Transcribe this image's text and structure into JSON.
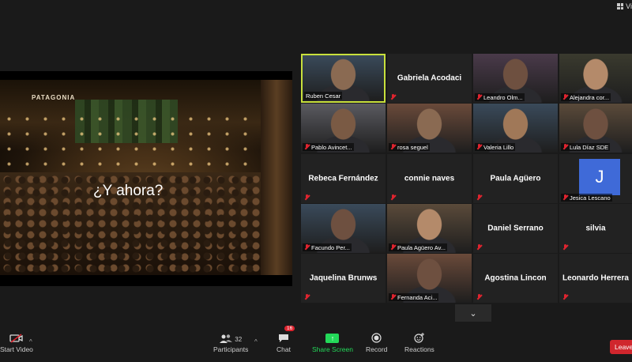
{
  "topbar": {
    "view_label": "Vi"
  },
  "shared_screen": {
    "overlay_text": "¿Y ahora?",
    "sign_text": "PATAGONIA"
  },
  "participants": [
    {
      "name": "Ruben Cesar",
      "video": true
    },
    {
      "name": "Gabriela Acodaci",
      "video": false
    },
    {
      "name": "Leandro Olm...",
      "video": true
    },
    {
      "name": "Alejandra cor...",
      "video": true
    },
    {
      "name": "Pablo Avincet...",
      "video": true
    },
    {
      "name": "rosa seguel",
      "video": true
    },
    {
      "name": "Valeria Lillo",
      "video": true
    },
    {
      "name": "Lula Díaz SDE",
      "video": true
    },
    {
      "name": "Rebeca Fernández",
      "video": false
    },
    {
      "name": "connie naves",
      "video": false
    },
    {
      "name": "Paula Agüero",
      "video": false
    },
    {
      "name": "Jesica Lescano",
      "avatar_letter": "J"
    },
    {
      "name": "Facundo Per...",
      "video": true
    },
    {
      "name": "Paula Agüero Av...",
      "video": true
    },
    {
      "name": "Daniel Serrano",
      "video": false
    },
    {
      "name": "silvia",
      "video": false
    },
    {
      "name": "Jaquelina Brunws",
      "video": false
    },
    {
      "name": "Fernanda Aci...",
      "video": true
    },
    {
      "name": "Agostina Lincon",
      "video": false
    },
    {
      "name": "Leonardo Herrera",
      "video": false
    }
  ],
  "more_button": {
    "icon": "chevron-down-icon",
    "glyph": "⌄"
  },
  "toolbar": {
    "start_video": "Start Video",
    "participants": "Participants",
    "participants_count": "32",
    "chat": "Chat",
    "chat_badge": "16",
    "share_screen": "Share Screen",
    "record": "Record",
    "reactions": "Reactions",
    "leave": "Leave"
  },
  "colors": {
    "active_speaker": "#c8e03c",
    "share_green": "#23d959",
    "mute_red": "#e0242f",
    "avatar_blue": "#3f6ad8"
  }
}
